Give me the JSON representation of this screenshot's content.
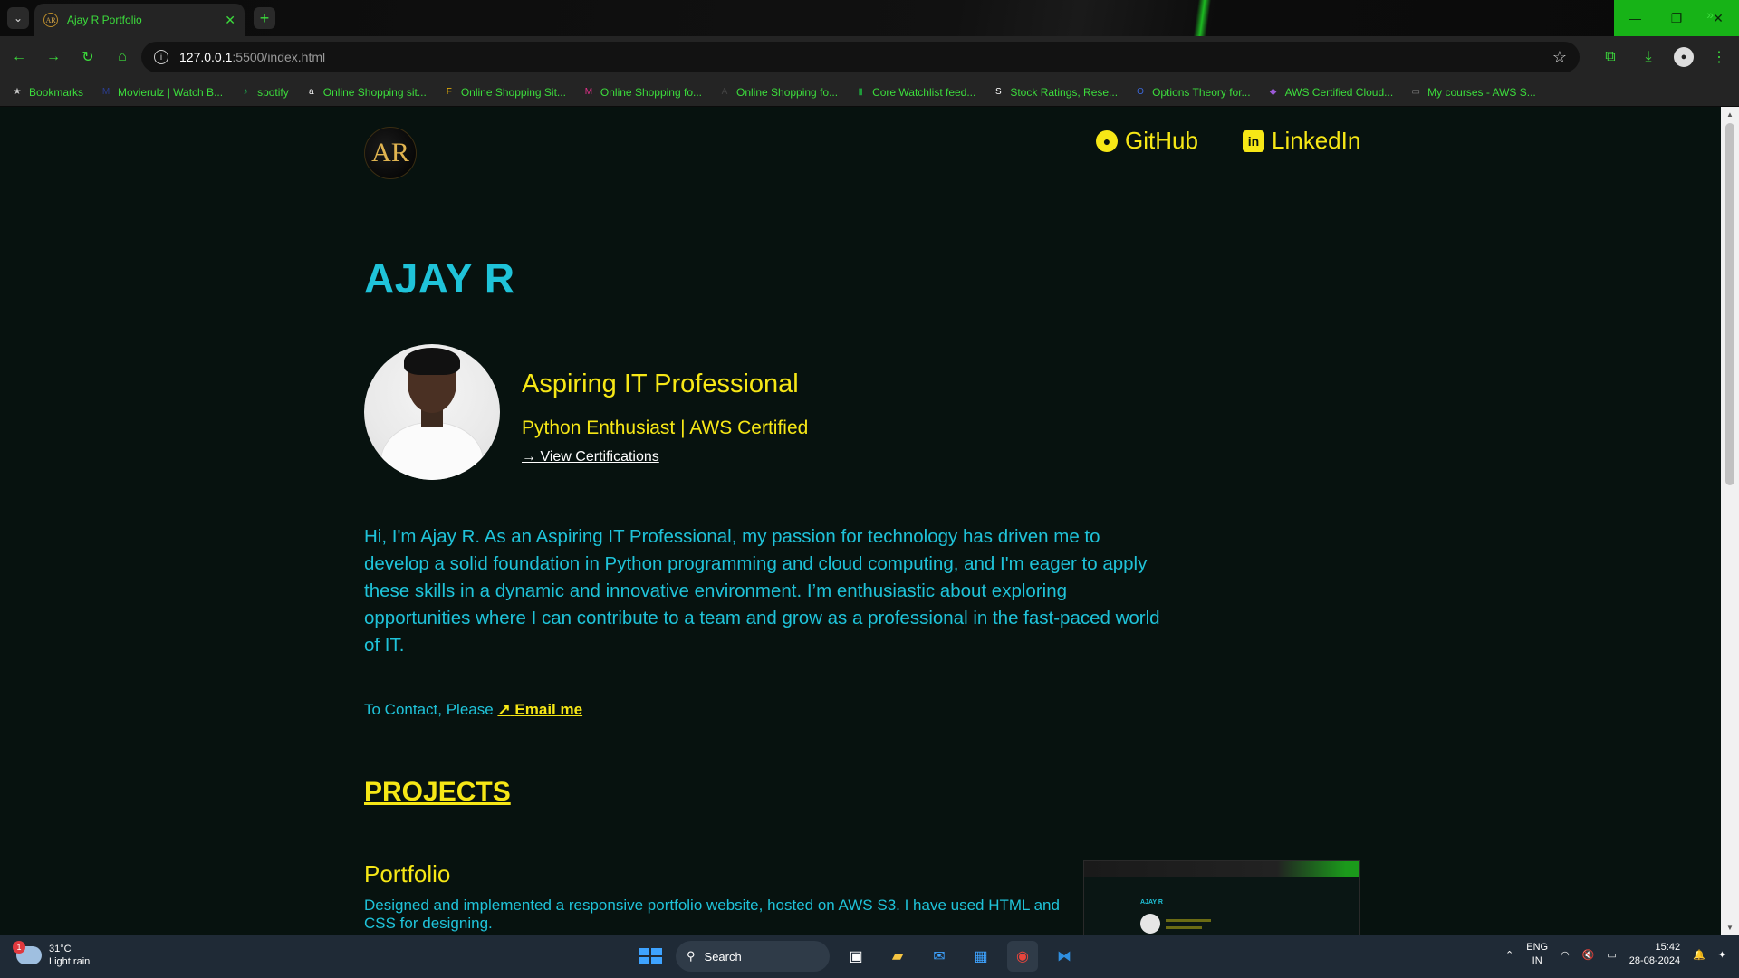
{
  "browser": {
    "tab_title": "Ajay R Portfolio",
    "favicon_text": "AR",
    "url_host": "127.0.0.1",
    "url_rest": ":5500/index.html",
    "bookmarks": [
      {
        "label": "Bookmarks",
        "icon": "★",
        "color": "#cccccc"
      },
      {
        "label": "Movierulz | Watch B...",
        "icon": "M",
        "color": "#2b3d8f"
      },
      {
        "label": "spotify",
        "icon": "♪",
        "color": "#1db954"
      },
      {
        "label": "Online Shopping sit...",
        "icon": "a",
        "color": "#ffffff"
      },
      {
        "label": "Online Shopping Sit...",
        "icon": "F",
        "color": "#f2b705"
      },
      {
        "label": "Online Shopping fo...",
        "icon": "M",
        "color": "#e3308a"
      },
      {
        "label": "Online Shopping fo...",
        "icon": "A",
        "color": "#444444"
      },
      {
        "label": "Core Watchlist feed...",
        "icon": "▮",
        "color": "#1e9e3a"
      },
      {
        "label": "Stock Ratings, Rese...",
        "icon": "S",
        "color": "#ffffff"
      },
      {
        "label": "Options Theory for...",
        "icon": "O",
        "color": "#3b66d6"
      },
      {
        "label": "AWS Certified Cloud...",
        "icon": "◆",
        "color": "#9b59d6"
      },
      {
        "label": "My courses - AWS S...",
        "icon": "▭",
        "color": "#888888"
      }
    ]
  },
  "page": {
    "logo_text": "AR",
    "nav": {
      "github": "GitHub",
      "linkedin": "LinkedIn"
    },
    "name": "AJAY R",
    "tagline": "Aspiring IT Professional",
    "subtagline": "Python Enthusiast | AWS Certified",
    "cert_link": "→ View Certifications",
    "about": "Hi, I'm Ajay R. As an Aspiring IT Professional, my passion for technology has driven me to develop a solid foundation in Python programming and cloud computing, and I'm eager to apply these skills in a dynamic and innovative environment. I’m enthusiastic about exploring opportunities where I can contribute to a team and grow as a professional in the fast-paced world of IT.",
    "contact_prefix": "To Contact, Please",
    "contact_arrow": "↗",
    "contact_link": "Email me",
    "projects_heading": "PROJECTS",
    "project": {
      "title": "Portfolio",
      "description": "Designed and implemented a responsive portfolio website, hosted on AWS S3. I have used HTML and CSS for designing.",
      "thumb_name": "AJAY R"
    }
  },
  "taskbar": {
    "weather_temp": "31°C",
    "weather_desc": "Light rain",
    "weather_badge": "1",
    "search_label": "Search",
    "lang_top": "ENG",
    "lang_bottom": "IN",
    "time": "15:42",
    "date": "28-08-2024"
  },
  "colors": {
    "accent_cyan": "#1fc3d9",
    "accent_yellow": "#f6e716",
    "page_bg": "#07120f",
    "chrome_green": "#3cdc3c"
  }
}
